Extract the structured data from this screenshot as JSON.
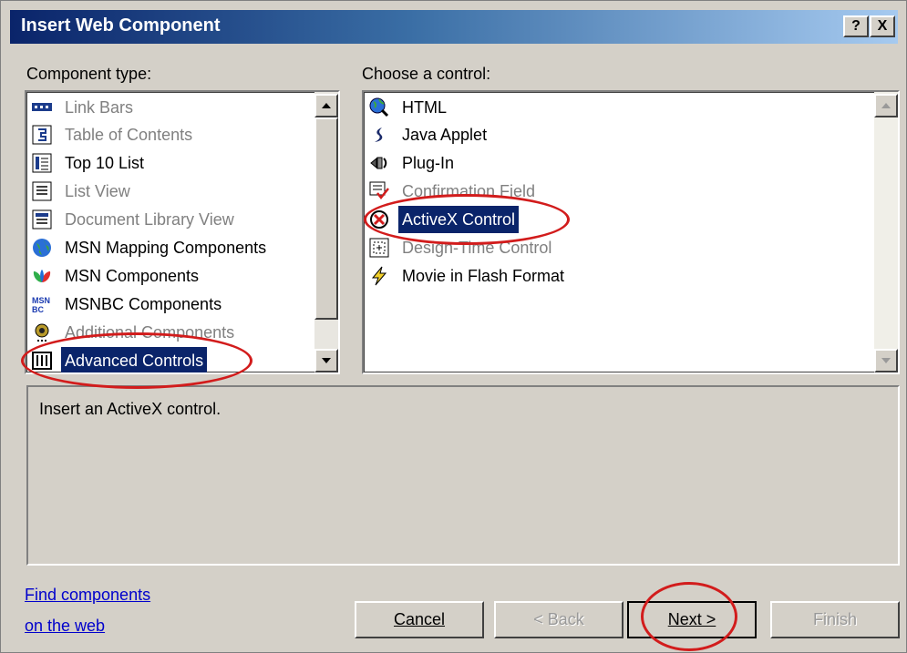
{
  "window": {
    "title": "Insert Web Component",
    "help_label": "?",
    "close_label": "X"
  },
  "component_type": {
    "label": "Component type:",
    "items": [
      {
        "label": "Link Bars",
        "icon": "link-bars-icon",
        "disabled": true
      },
      {
        "label": "Table of Contents",
        "icon": "table-of-contents-icon",
        "disabled": true
      },
      {
        "label": "Top 10 List",
        "icon": "top-10-list-icon",
        "disabled": false
      },
      {
        "label": "List View",
        "icon": "list-view-icon",
        "disabled": true
      },
      {
        "label": "Document Library View",
        "icon": "document-library-icon",
        "disabled": true
      },
      {
        "label": "MSN Mapping Components",
        "icon": "globe-icon",
        "disabled": false
      },
      {
        "label": "MSN Components",
        "icon": "msn-butterfly-icon",
        "disabled": false
      },
      {
        "label": "MSNBC Components",
        "icon": "msnbc-icon",
        "disabled": false
      },
      {
        "label": "Additional Components",
        "icon": "additional-components-icon",
        "disabled": true
      },
      {
        "label": "Advanced Controls",
        "icon": "advanced-controls-icon",
        "selected": true
      }
    ]
  },
  "choose_control": {
    "label": "Choose a control:",
    "items": [
      {
        "label": "HTML",
        "icon": "html-icon",
        "disabled": false
      },
      {
        "label": "Java Applet",
        "icon": "java-applet-icon",
        "disabled": false
      },
      {
        "label": "Plug-In",
        "icon": "plug-in-icon",
        "disabled": false
      },
      {
        "label": "Confirmation Field",
        "icon": "confirmation-field-icon",
        "disabled": true
      },
      {
        "label": "ActiveX Control",
        "icon": "activex-icon",
        "selected": true
      },
      {
        "label": "Design-Time Control",
        "icon": "design-time-icon",
        "disabled": true
      },
      {
        "label": "Movie in Flash Format",
        "icon": "flash-icon",
        "disabled": false
      }
    ]
  },
  "description": "Insert an ActiveX control.",
  "find_link": {
    "line1": "Find components",
    "line2": "on the web"
  },
  "buttons": {
    "cancel": "Cancel",
    "back": "< Back",
    "next": "Next >",
    "finish": "Finish"
  },
  "colors": {
    "selection": "#0a246a",
    "annotation": "#d21c1c",
    "face": "#d4d0c8"
  }
}
